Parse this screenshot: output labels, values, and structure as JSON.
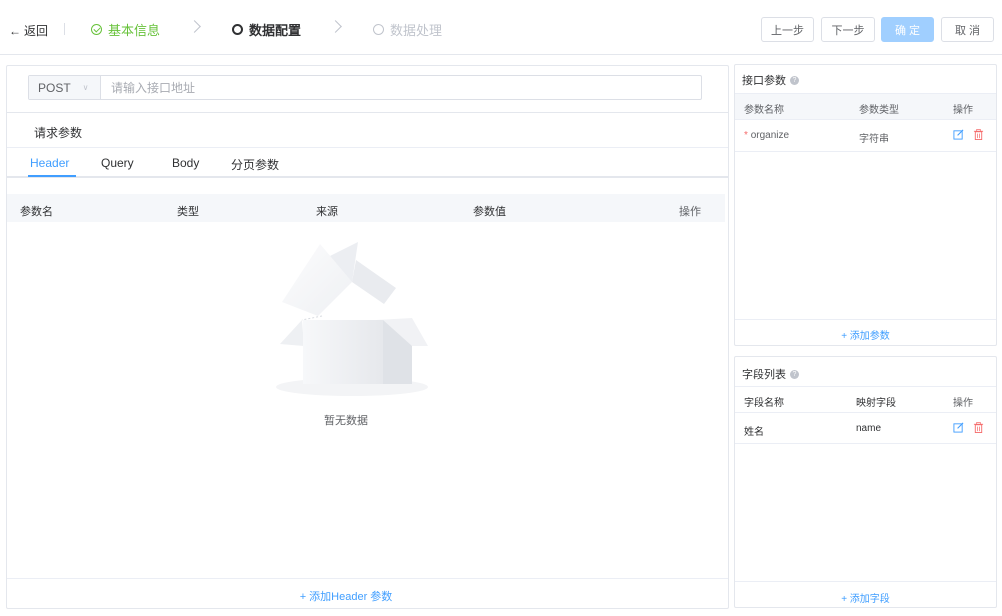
{
  "header": {
    "back_label": "返回",
    "steps": [
      {
        "label": "基本信息",
        "status": "done"
      },
      {
        "label": "数据配置",
        "status": "active"
      },
      {
        "label": "数据处理",
        "status": "pending"
      }
    ],
    "buttons": {
      "prev": "上一步",
      "next": "下一步",
      "confirm": "确 定",
      "cancel": "取 消"
    }
  },
  "request": {
    "method": "POST",
    "url_placeholder": "请输入接口地址",
    "url_value": "",
    "section_title": "请求参数",
    "tabs": [
      "Header",
      "Query",
      "Body",
      "分页参数"
    ],
    "active_tab": "Header",
    "table_headers": [
      "参数名",
      "类型",
      "来源",
      "参数值",
      "操作"
    ],
    "empty_text": "暂无数据",
    "add_label": "+ 添加Header 参数"
  },
  "api_params": {
    "title": "接口参数",
    "headers": [
      "参数名称",
      "参数类型",
      "操作"
    ],
    "rows": [
      {
        "required_mark": "*",
        "name": "organize",
        "type": "字符串"
      }
    ],
    "add_label": "+ 添加参数"
  },
  "field_list": {
    "title": "字段列表",
    "headers": [
      "字段名称",
      "映射字段",
      "操作"
    ],
    "rows": [
      {
        "name": "姓名",
        "mapping": "name"
      }
    ],
    "add_label": "+ 添加字段"
  },
  "colors": {
    "primary": "#409eff",
    "success": "#67c23a",
    "danger": "#f56c6c",
    "disabled_primary": "#a0cfff"
  }
}
